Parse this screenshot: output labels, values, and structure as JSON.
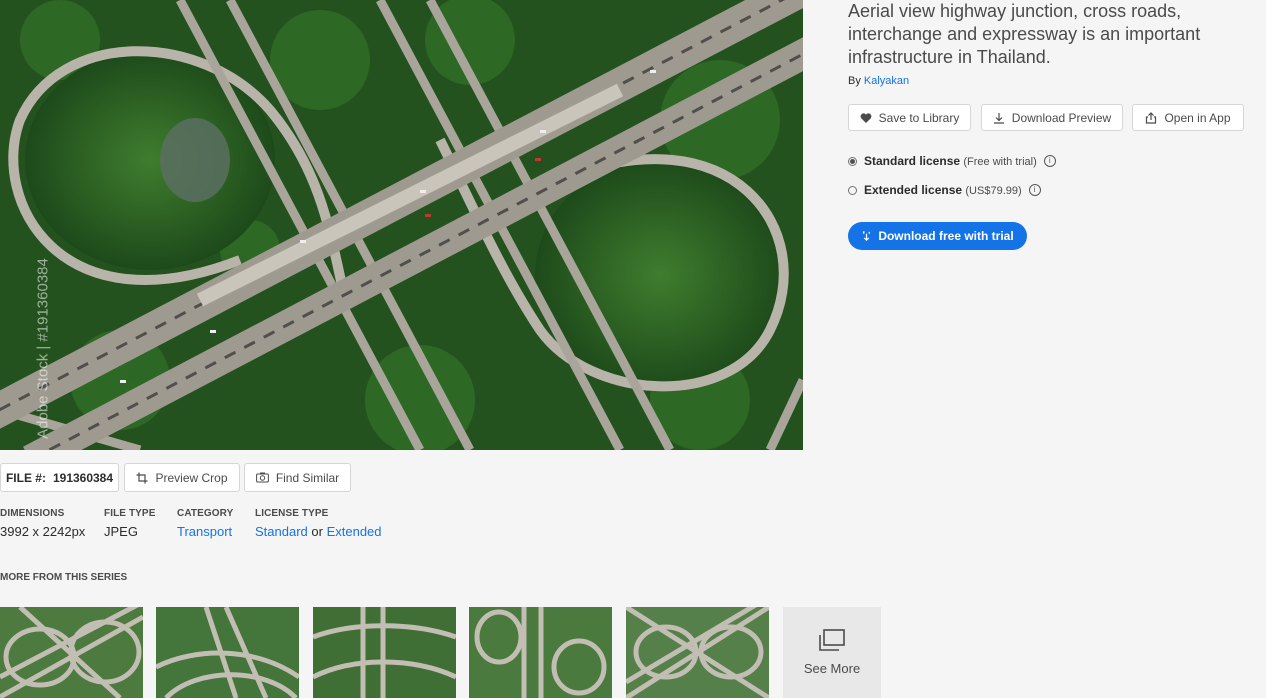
{
  "image": {
    "watermark": "Adobe Stock | #191360384"
  },
  "asset": {
    "title": "Aerial view highway junction, cross roads, interchange and expressway is an important infrastructure in Thailand.",
    "by_prefix": "By",
    "author": "Kalyakan"
  },
  "actions": {
    "save": "Save to Library",
    "download_preview": "Download Preview",
    "open_in_app": "Open in App"
  },
  "licenses": [
    {
      "name": "Standard license",
      "detail": "(Free with trial)",
      "selected": true
    },
    {
      "name": "Extended license",
      "detail": "(US$79.99)",
      "selected": false
    }
  ],
  "cta": {
    "label": "Download free with trial"
  },
  "file_bar": {
    "file_label": "FILE #:",
    "file_number": "191360384",
    "preview_crop": "Preview Crop",
    "find_similar": "Find Similar"
  },
  "meta": {
    "dimensions_label": "DIMENSIONS",
    "dimensions": "3992 x 2242px",
    "file_type_label": "FILE TYPE",
    "file_type": "JPEG",
    "category_label": "CATEGORY",
    "category": "Transport",
    "license_type_label": "LICENSE TYPE",
    "license_standard": "Standard",
    "license_or": "or",
    "license_extended": "Extended"
  },
  "series": {
    "heading": "MORE FROM THIS SERIES",
    "see_more": "See More"
  },
  "colors": {
    "accent": "#1473e6",
    "background": "#f5f5f5",
    "button_border": "#d6d6d6",
    "foliage_dark": "#1f4a1f",
    "road": "#b8b4aa"
  }
}
